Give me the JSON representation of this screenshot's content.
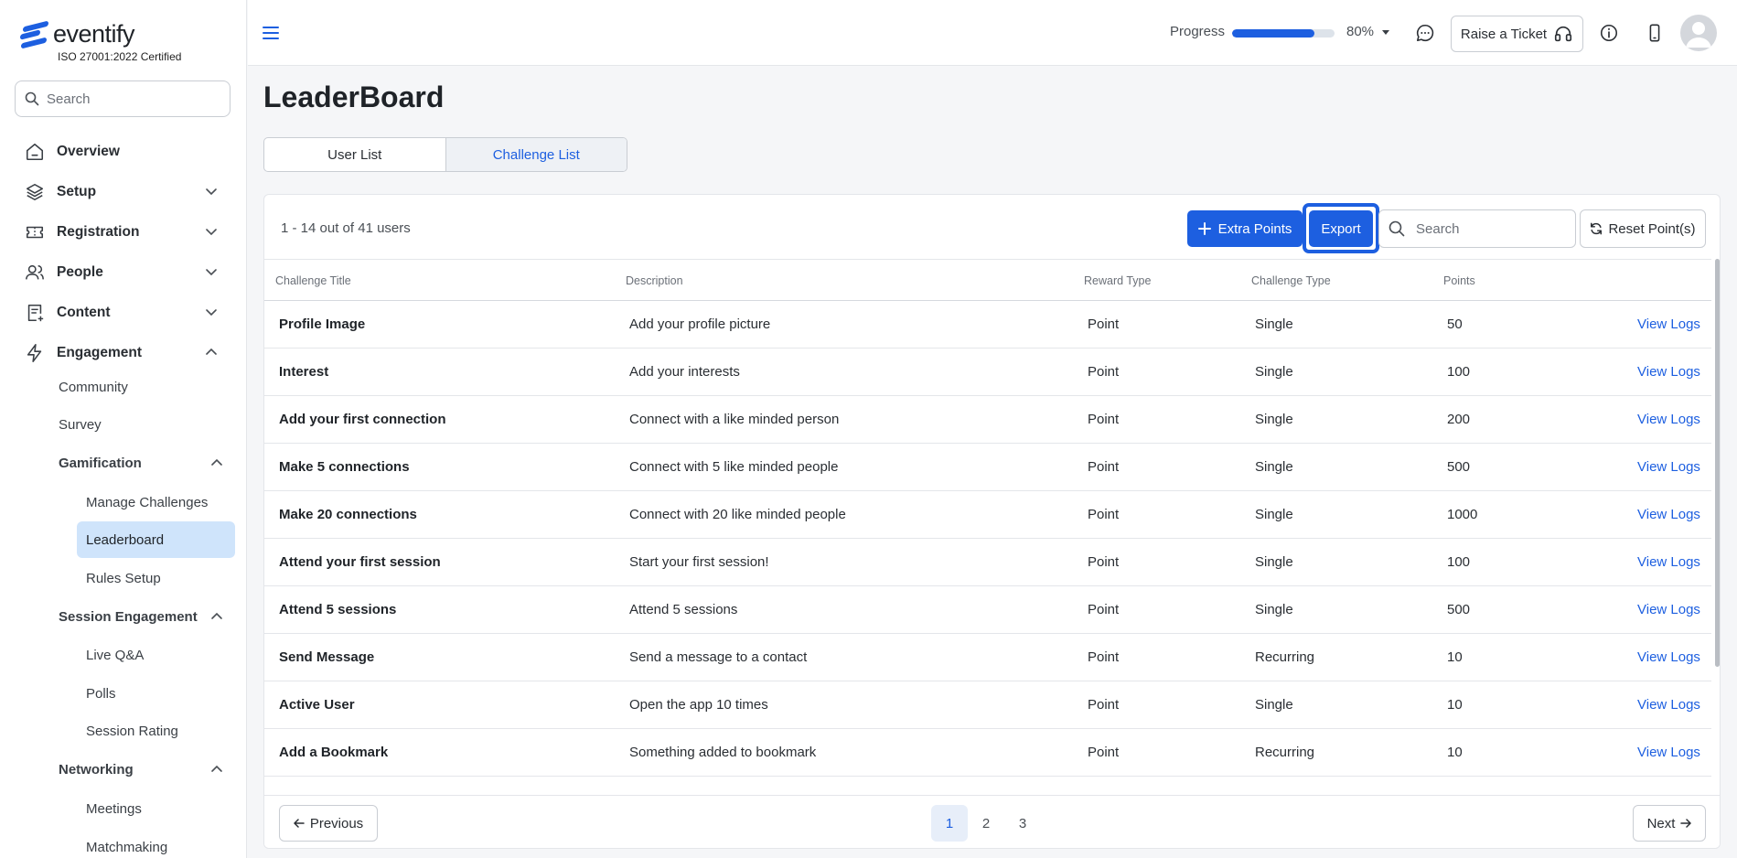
{
  "brand": {
    "name": "eventify",
    "certification": "ISO 27001:2022 Certified"
  },
  "sidebar": {
    "search_placeholder": "Search",
    "nav": [
      {
        "label": "Overview",
        "icon": "home-icon"
      },
      {
        "label": "Setup",
        "icon": "layers-icon"
      },
      {
        "label": "Registration",
        "icon": "ticket-icon"
      },
      {
        "label": "People",
        "icon": "users-icon"
      },
      {
        "label": "Content",
        "icon": "document-add-icon"
      },
      {
        "label": "Engagement",
        "icon": "lightning-icon"
      }
    ],
    "engagement": {
      "community": "Community",
      "survey": "Survey",
      "gamification": {
        "label": "Gamification",
        "items": [
          "Manage Challenges",
          "Leaderboard",
          "Rules Setup"
        ],
        "active": "Leaderboard"
      },
      "session_engagement": {
        "label": "Session Engagement",
        "items": [
          "Live Q&A",
          "Polls",
          "Session Rating"
        ]
      },
      "networking": {
        "label": "Networking",
        "items": [
          "Meetings",
          "Matchmaking"
        ]
      }
    }
  },
  "topbar": {
    "progress_label": "Progress",
    "progress_value": 0.8,
    "progress_text": "80%",
    "raise_ticket": "Raise a Ticket",
    "icons": [
      "menu-icon",
      "chat-icon",
      "headset-icon",
      "info-icon",
      "mobile-icon",
      "avatar"
    ]
  },
  "main": {
    "title": "LeaderBoard",
    "tabs": [
      {
        "label": "User List",
        "active": false
      },
      {
        "label": "Challenge List",
        "active": true
      }
    ],
    "count_text": "1 - 14 out of 41 users",
    "extra_points": "Extra Points",
    "export": "Export",
    "search_placeholder": "Search",
    "reset_points": "Reset Point(s)",
    "columns": [
      "Challenge Title",
      "Description",
      "Reward Type",
      "Challenge Type",
      "Points"
    ],
    "rows": [
      {
        "title": "Profile Image",
        "description": "Add your profile picture",
        "reward": "Point",
        "type": "Single",
        "points": "50",
        "action": "View Logs"
      },
      {
        "title": "Interest",
        "description": "Add your interests",
        "reward": "Point",
        "type": "Single",
        "points": "100",
        "action": "View Logs"
      },
      {
        "title": "Add your first connection",
        "description": "Connect with a like minded person",
        "reward": "Point",
        "type": "Single",
        "points": "200",
        "action": "View Logs"
      },
      {
        "title": "Make 5 connections",
        "description": "Connect with 5 like minded people",
        "reward": "Point",
        "type": "Single",
        "points": "500",
        "action": "View Logs"
      },
      {
        "title": "Make 20 connections",
        "description": "Connect with 20 like minded people",
        "reward": "Point",
        "type": "Single",
        "points": "1000",
        "action": "View Logs"
      },
      {
        "title": "Attend your first session",
        "description": "Start your first session!",
        "reward": "Point",
        "type": "Single",
        "points": "100",
        "action": "View Logs"
      },
      {
        "title": "Attend 5 sessions",
        "description": "Attend 5 sessions",
        "reward": "Point",
        "type": "Single",
        "points": "500",
        "action": "View Logs"
      },
      {
        "title": "Send Message",
        "description": "Send a message to a contact",
        "reward": "Point",
        "type": "Recurring",
        "points": "10",
        "action": "View Logs"
      },
      {
        "title": "Active User",
        "description": "Open the app 10 times",
        "reward": "Point",
        "type": "Single",
        "points": "10",
        "action": "View Logs"
      },
      {
        "title": "Add a Bookmark",
        "description": "Something added to bookmark",
        "reward": "Point",
        "type": "Recurring",
        "points": "10",
        "action": "View Logs"
      }
    ],
    "pagination": {
      "previous": "Previous",
      "next": "Next",
      "pages": [
        "1",
        "2",
        "3"
      ],
      "current": "1"
    }
  },
  "colors": {
    "accent": "#1d5fe0",
    "active_nav_bg": "#cfe4fb"
  }
}
